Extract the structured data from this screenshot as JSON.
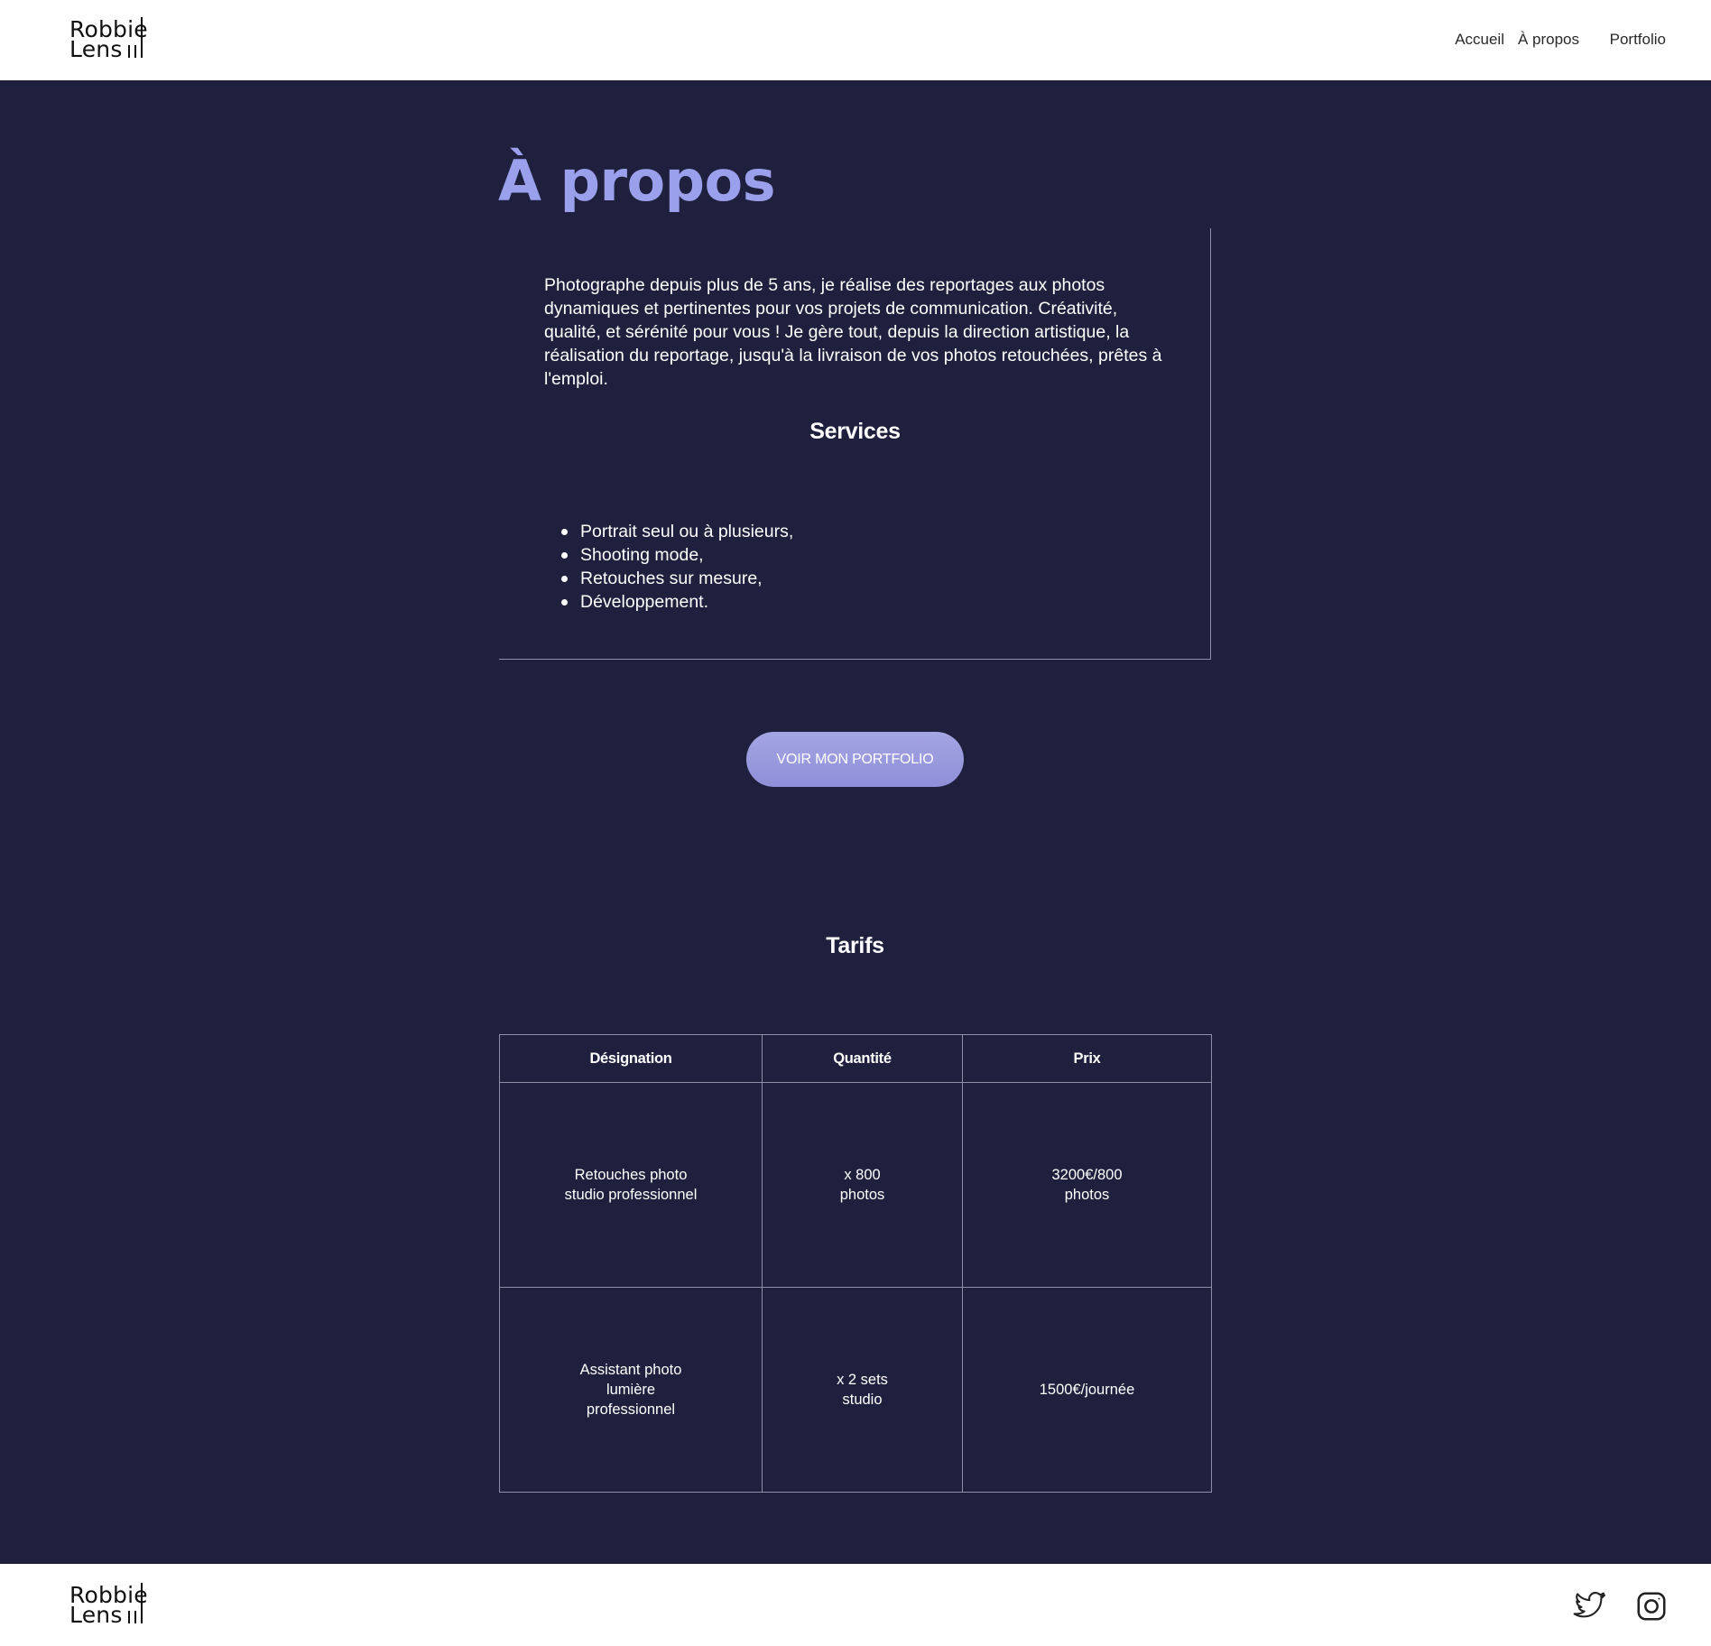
{
  "header": {
    "logo_line1": "Robbie",
    "logo_line2": "Lens",
    "nav": [
      "Accueil",
      "À propos",
      "Portfolio"
    ]
  },
  "main": {
    "title": "À propos",
    "about_text": "Photographe depuis plus de 5 ans, je réalise des reportages aux photos dynamiques et pertinentes pour vos projets de communication. Créativité, qualité, et sérénité pour vous ! Je gère tout, depuis la direction artistique, la réalisation du reportage, jusqu'à la livraison de vos photos retouchées, prêtes à l'emploi.",
    "services_title": "Services",
    "services": [
      "Portrait seul ou à plusieurs,",
      "Shooting mode,",
      "Retouches sur mesure,",
      "Développement."
    ],
    "cta_label": "VOIR MON PORTFOLIO",
    "tarifs_title": "Tarifs",
    "table": {
      "headers": [
        "Désignation",
        "Quantité",
        "Prix"
      ],
      "rows": [
        [
          "Retouches photo studio professionnel",
          "x 800 photos",
          "3200€/800 photos"
        ],
        [
          "Assistant photo lumière professionnel",
          "x 2 sets studio",
          "1500€/journée"
        ]
      ]
    }
  },
  "footer": {
    "logo_line1": "Robbie",
    "logo_line2": "Lens",
    "social": [
      "twitter-icon",
      "instagram-icon"
    ]
  },
  "colors": {
    "background": "#1f203d",
    "accent": "#9aa0ec",
    "button": "#9b9ce0",
    "border": "#8f90a8"
  }
}
